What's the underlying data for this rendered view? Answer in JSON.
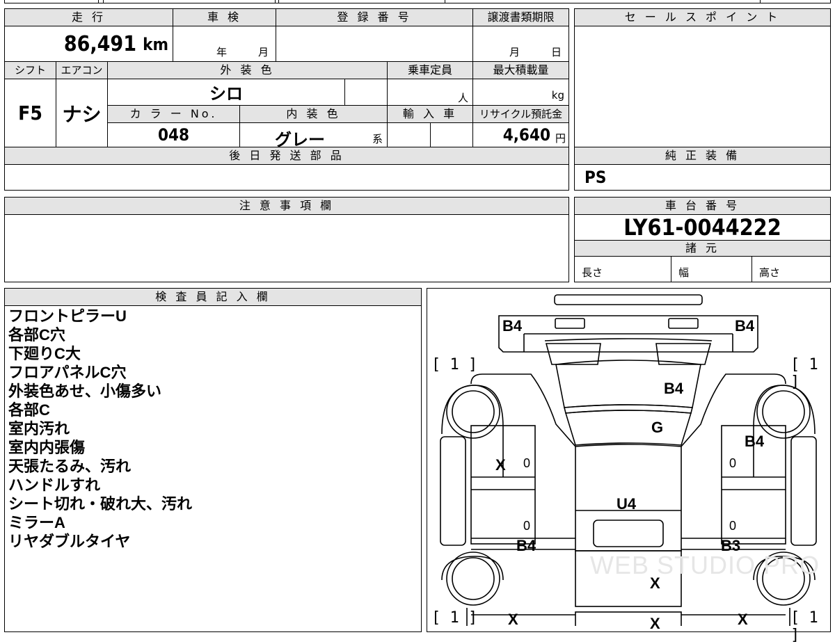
{
  "vehicle": {
    "mileage_label": "走 行",
    "mileage_value": "86,491",
    "mileage_unit": "km",
    "inspection_label": "車 検",
    "inspection_year": "年",
    "inspection_month": "月",
    "registration_label": "登 録 番 号",
    "deadline_label": "譲渡書類期限",
    "deadline_month": "月",
    "deadline_day": "日",
    "shift_label": "シフト",
    "shift_value": "F5",
    "ac_label": "エアコン",
    "ac_value": "ナシ",
    "exterior_label": "外 装 色",
    "exterior_value": "シロ",
    "capacity_label": "乗車定員",
    "capacity_unit": "人",
    "load_label": "最大積載量",
    "load_unit": "kg",
    "color_no_label": "カ ラ ー No.",
    "color_no_value": "048",
    "interior_label": "内 装 色",
    "interior_value": "グレー",
    "interior_suffix": "系",
    "import_label": "輸 入 車",
    "recycle_label": "リサイクル預託金",
    "recycle_value": "4,640",
    "recycle_unit": "円",
    "later_parts_label": "後 日 発 送 部 品",
    "notes_label": "注 意 事 項 欄"
  },
  "sales": {
    "sales_point_label": "セ ー ル ス ポ イ ン ト",
    "genuine_label": "純 正 装 備",
    "genuine_value": "PS",
    "chassis_label": "車 台 番 号",
    "chassis_value": "LY61-0044222",
    "specs_label": "諸 元",
    "length_label": "長さ",
    "width_label": "幅",
    "height_label": "高さ"
  },
  "inspector": {
    "title": "検 査 員 記 入 欄",
    "lines": [
      "フロントピラーU",
      "各部C穴",
      "下廻りC大",
      "フロアパネルC穴",
      "外装色あせ、小傷多い",
      "各部C",
      "室内汚れ",
      "室内内張傷",
      "天張たるみ、汚れ",
      "ハンドルすれ",
      "シート切れ・破れ大、汚れ",
      "ミラーA",
      "リヤダブルタイヤ"
    ]
  },
  "diagram": {
    "tyre_tl": "[ 1 ]",
    "tyre_tr": "[ 1 ]",
    "tyre_bl": "[ 1 ]",
    "tyre_br": "[ 1 ]",
    "b4_left_top": "B4",
    "b4_right_top": "B4",
    "b4_hood": "B4",
    "g_glass": "G",
    "b4_right_door": "B4",
    "x_left_door": "X",
    "zero_1": "0",
    "zero_2": "0",
    "u4_floor": "U4",
    "zero_3": "0",
    "zero_4": "0",
    "b4_left_step": "B4",
    "b3_right_step": "B3",
    "x_center": "X",
    "x_bl": "X",
    "x_bc": "X",
    "x_br": "X",
    "watermark": "WEB STUDIO PRO"
  }
}
